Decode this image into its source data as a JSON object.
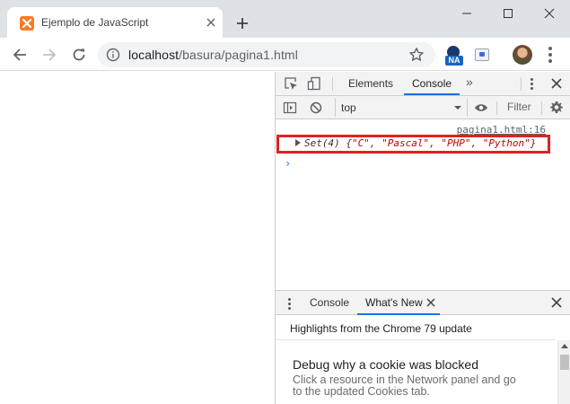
{
  "browser": {
    "tab_title": "Ejemplo de JavaScript",
    "url_host": "localhost",
    "url_path": "/basura/pagina1.html",
    "extension_badge": "NA"
  },
  "devtools": {
    "tabs": [
      "Elements",
      "Console"
    ],
    "active_tab": "Console",
    "more_tabs_glyph": "»",
    "context": "top",
    "filter_placeholder": "Filter",
    "console": {
      "source_link": "pagina1.html:16",
      "log_prefix": "Set(4) {",
      "log_values": [
        "\"C\"",
        "\"Pascal\"",
        "\"PHP\"",
        "\"Python\""
      ],
      "log_suffix": "}",
      "prompt_glyph": "›"
    },
    "drawer": {
      "tabs": [
        "Console",
        "What's New"
      ],
      "active_tab": "What's New",
      "header": "Highlights from the Chrome 79 update",
      "card_title": "Debug why a cookie was blocked",
      "card_body": "Click a resource in the Network panel and go to the updated Cookies tab."
    }
  },
  "colors": {
    "accent": "#1a73e8",
    "highlight_box": "#dd2222",
    "string_value": "#c80000",
    "favicon": "#fb7a24"
  }
}
